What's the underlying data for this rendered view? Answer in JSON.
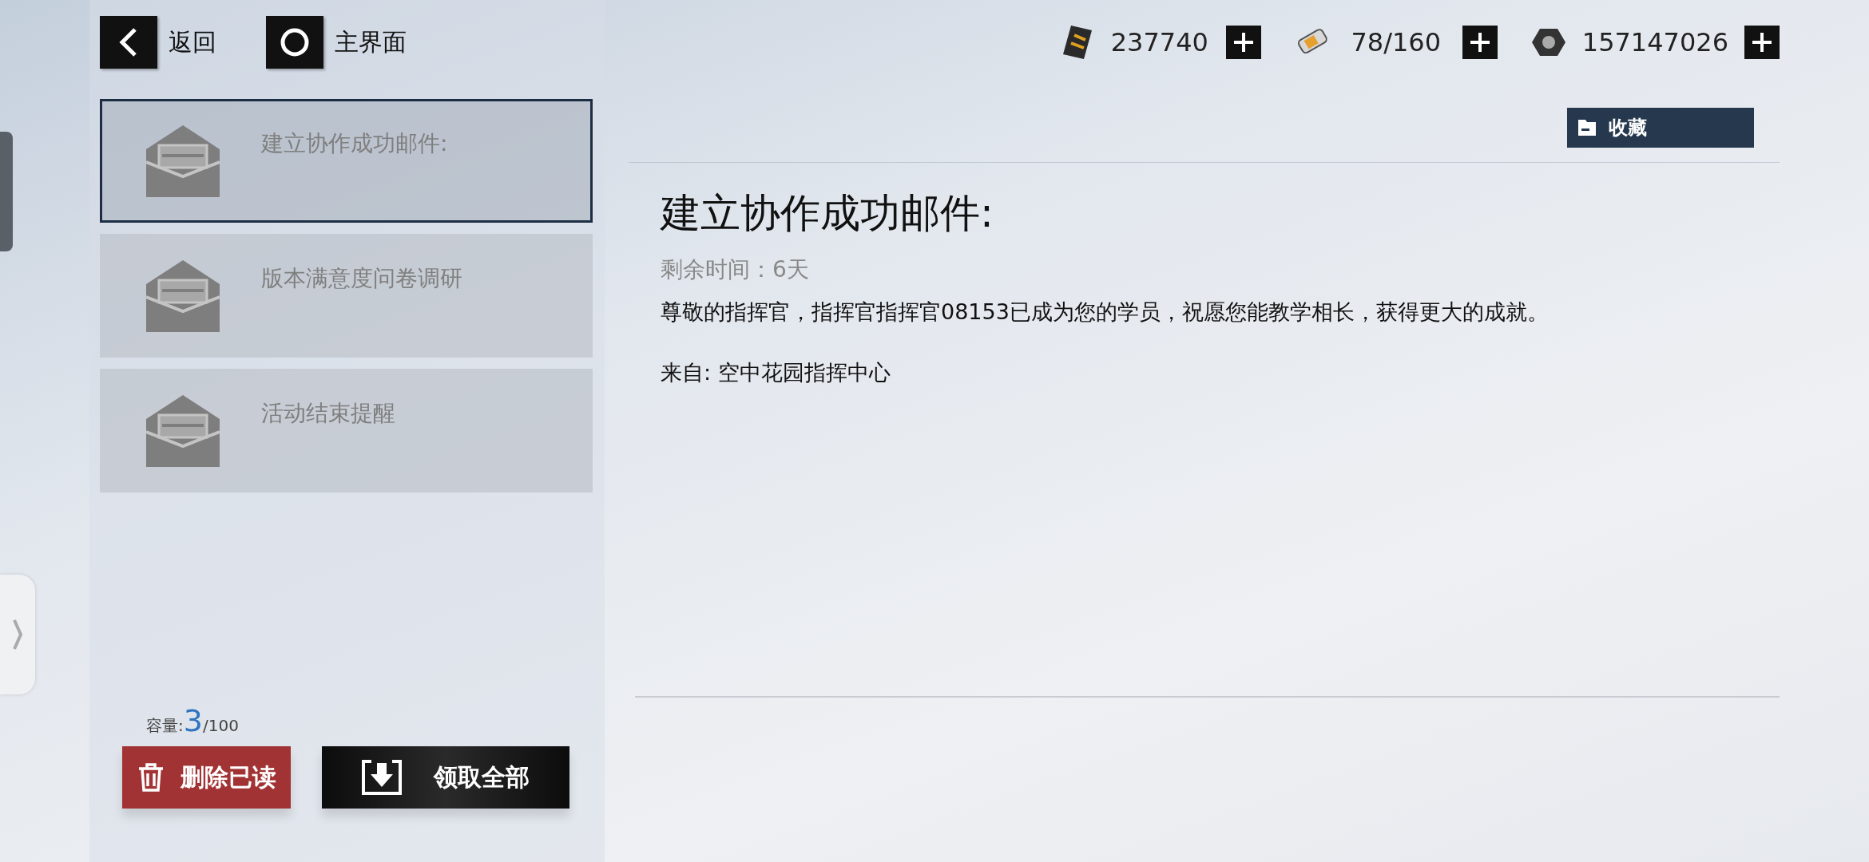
{
  "nav": [
    {
      "kind": "back",
      "label": "返回"
    },
    {
      "kind": "home",
      "label": "主界面"
    }
  ],
  "currencies": [
    {
      "kind": "card",
      "value": "237740"
    },
    {
      "kind": "battery",
      "value": "78/160"
    },
    {
      "kind": "nut",
      "value": "157147026"
    }
  ],
  "mails": [
    {
      "title": "建立协作成功邮件:",
      "selected": true
    },
    {
      "title": "版本满意度问卷调研",
      "selected": false
    },
    {
      "title": "活动结束提醒",
      "selected": false
    }
  ],
  "capacity": {
    "label": "容量:",
    "count": "3",
    "total": "/100"
  },
  "buttons": [
    {
      "kind": "delete",
      "label": "删除已读"
    },
    {
      "kind": "collect",
      "label": "领取全部"
    }
  ],
  "detail": {
    "favorite": "收藏",
    "title": "建立协作成功邮件:",
    "remaining": "剩余时间：6天",
    "body": "尊敬的指挥官，指挥官指挥官08153已成为您的学员，祝愿您能教学相长，获得更大的成就。",
    "sender": "来自: 空中花园指挥中心"
  }
}
